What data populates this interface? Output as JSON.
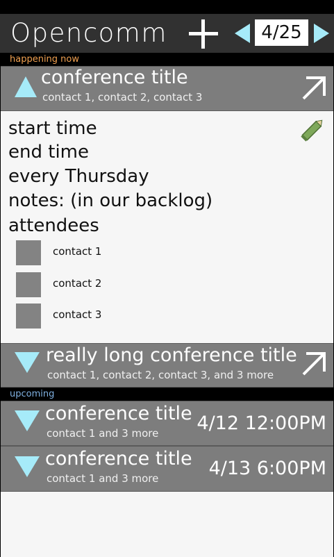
{
  "header": {
    "app_title": "Opencomm",
    "date": "4/25",
    "icons": {
      "add": "plus-icon",
      "prev": "left-triangle-icon",
      "next": "right-triangle-icon"
    }
  },
  "sections": {
    "now_label": "happening now",
    "upcoming_label": "upcoming"
  },
  "colors": {
    "header_bg": "#313131",
    "row_bg": "#7d7d7d",
    "accent": "#a6ebf9",
    "now_label": "#f0a050",
    "upcoming_label": "#7fb0e0",
    "edit_pencil": "#7ea85a"
  },
  "happening_now": [
    {
      "title": "conference title",
      "contacts": "contact 1, contact 2, contact 3",
      "expanded": true,
      "details": {
        "start": "start time",
        "end": "end time",
        "recurrence": "every Thursday",
        "notes": "notes: (in our backlog)",
        "attendees_heading": "attendees",
        "attendees": [
          "contact 1",
          "contact 2",
          "contact 3"
        ]
      }
    },
    {
      "title": "really long conference title",
      "contacts": "contact 1, contact 2, contact 3, and 3 more",
      "expanded": false
    }
  ],
  "upcoming": [
    {
      "title": "conference title",
      "contacts": "contact 1 and 3 more",
      "time": "4/12 12:00PM"
    },
    {
      "title": "conference title",
      "contacts": "contact 1 and 3 more",
      "time": "4/13 6:00PM"
    }
  ]
}
